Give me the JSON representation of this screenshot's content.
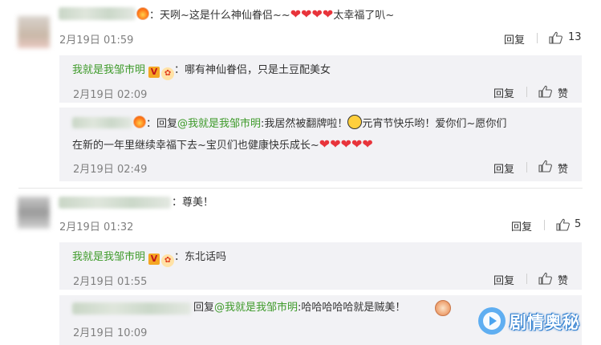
{
  "comments": [
    {
      "text_prefix": "：天咧~这是什么神仙眷侣~~",
      "hearts": "❤❤❤❤",
      "text_suffix": "太幸福了叭~",
      "time": "2月19日 01:59",
      "reply_label": "回复",
      "like_count": "13",
      "replies": [
        {
          "username": "我就是我邹市明",
          "vip_badge": "V",
          "text": "：哪有神仙眷侣，只是土豆配美女",
          "time": "2月19日 02:09",
          "reply_label": "回复",
          "like_label": "赞"
        },
        {
          "text_prefix": "：回复",
          "mention": "@我就是我邹市明",
          "text_mid": ":我居然被翻牌啦！",
          "text_after_emoji": "元宵节快乐哟！爱你们~愿你们",
          "text_line2": "在新的一年里继续幸福下去~宝贝们也健康快乐成长~",
          "hearts": "❤❤❤❤❤",
          "time": "2月19日 02:49",
          "reply_label": "回复",
          "like_label": "赞"
        }
      ]
    },
    {
      "text": "：尊美！",
      "time": "2月19日 01:32",
      "reply_label": "回复",
      "like_count": "5",
      "replies": [
        {
          "username": "我就是我邹市明",
          "vip_badge": "V",
          "text": "：东北话吗",
          "time": "2月19日 01:55",
          "reply_label": "回复",
          "like_label": "赞"
        },
        {
          "text_prefix": "回复",
          "mention": "@我就是我邹市明",
          "text": ":哈哈哈哈哈就是贼美！",
          "time": "2月19日 10:09"
        }
      ]
    }
  ],
  "watermark": {
    "text": "剧情奥秘"
  },
  "colors": {
    "accent": "#3e9a2a",
    "heart": "#e8343b",
    "reply_bg": "#f2f2f5"
  }
}
